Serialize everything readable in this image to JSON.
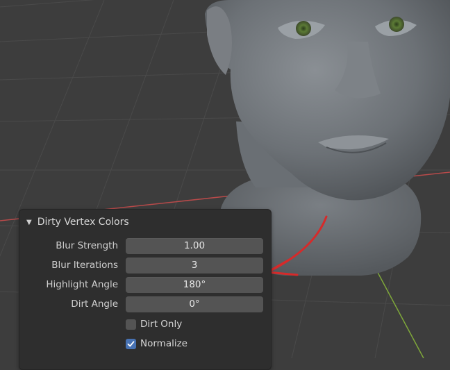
{
  "panel": {
    "title": "Dirty Vertex Colors",
    "fields": [
      {
        "label": "Blur Strength",
        "value": "1.00"
      },
      {
        "label": "Blur Iterations",
        "value": "3"
      },
      {
        "label": "Highlight Angle",
        "value": "180°"
      },
      {
        "label": "Dirt Angle",
        "value": "0°"
      }
    ],
    "checkboxes": [
      {
        "label": "Dirt Only",
        "checked": false
      },
      {
        "label": "Normalize",
        "checked": true
      }
    ]
  },
  "colors": {
    "accent": "#4772b3",
    "annotation_arrow": "#d62a2a",
    "x_axis": "#b84a4a",
    "y_axis": "#7fa83a"
  }
}
